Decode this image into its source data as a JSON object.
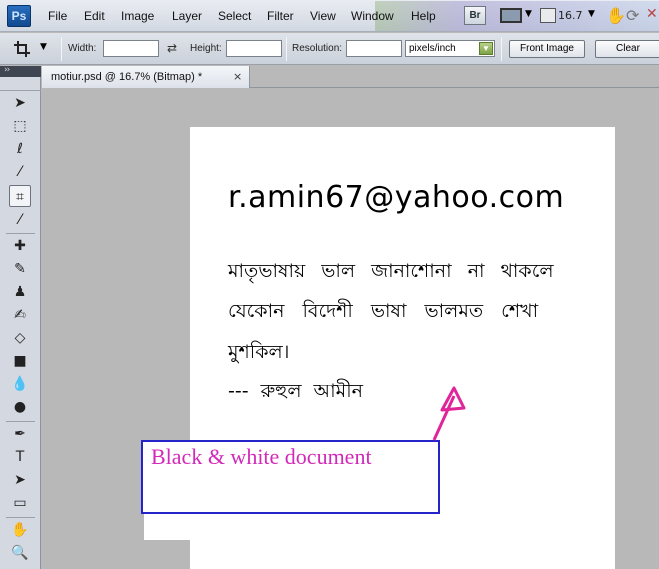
{
  "app": {
    "logo": "Ps"
  },
  "menu": [
    "File",
    "Edit",
    "Image",
    "Layer",
    "Select",
    "Filter",
    "View",
    "Window",
    "Help"
  ],
  "titlebar": {
    "bridge_label": "Br",
    "zoom": "16.7"
  },
  "options": {
    "width_label": "Width:",
    "width_value": "",
    "height_label": "Height:",
    "height_value": "",
    "resolution_label": "Resolution:",
    "resolution_value": "",
    "unit": "pixels/inch",
    "front_image_label": "Front Image",
    "clear_label": "Clear"
  },
  "document_tab": {
    "title": "motiur.psd @ 16.7% (Bitmap) *",
    "close": "×"
  },
  "document": {
    "email": "r.amin67@yahoo.com",
    "lines": [
      "মাতৃভাষায় ভাল জানাশোনা না থাকলে",
      "যেকোন বিদেশী ভাষা ভালমত  শেখা",
      "মুশকিল।",
      "--- রুহুল আমীন"
    ]
  },
  "annotation": {
    "text": "Black & white document",
    "text_color": "#d22ab8",
    "box_color": "#2424c8",
    "arrow_color": "#e0259a"
  }
}
